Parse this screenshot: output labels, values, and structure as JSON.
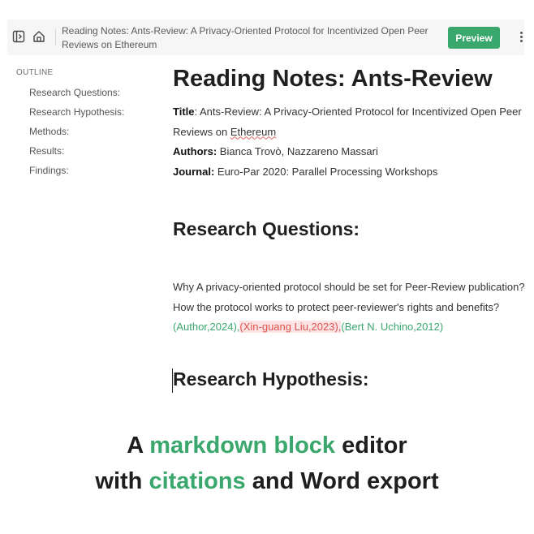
{
  "topbar": {
    "doc_title": "Reading Notes: Ants-Review: A Privacy-Oriented Protocol for Incentivized Open Peer Reviews on Ethereum",
    "preview_label": "Preview",
    "icons": [
      "sidebar-toggle-icon",
      "home-icon",
      "more-vertical-icon"
    ]
  },
  "outline": {
    "title": "OUTLINE",
    "items": [
      {
        "label": "Research Questions:"
      },
      {
        "label": "Research Hypothesis:"
      },
      {
        "label": "Methods:"
      },
      {
        "label": "Results:"
      },
      {
        "label": "Findings:"
      }
    ]
  },
  "doc": {
    "heading": "Reading Notes: Ants-Review",
    "title_label": "Title",
    "title_text_a": ": Ants-Review: A Privacy-Oriented Protocol for Incentivized Open Peer Reviews on ",
    "title_text_b": "Ethereum",
    "authors_label": "Authors:",
    "authors": " Bianca Trovò, Nazzareno Massari",
    "journal_label": "Journal:",
    "journal": " Euro-Par 2020: Parallel Processing Workshops",
    "section1": "Research Questions:",
    "q1": "Why A privacy-oriented protocol should be set for Peer-Review publication?",
    "q2": "How the protocol works to protect peer-reviewer's rights and benefits? ",
    "cite1": "(Author,2024),",
    "cite2": "(Xin-guang Liu,2023),",
    "cite3": "(Bert N. Uchino,2012)",
    "section2": "Research Hypothesis:"
  },
  "banner": {
    "line1_a": "A ",
    "line1_hl": "markdown block",
    "line1_b": " editor",
    "line2_a": "with ",
    "line2_hl": "citations",
    "line2_b": " and Word export"
  },
  "colors": {
    "accent": "#3aa76d",
    "citation_error": "#e0524f"
  }
}
